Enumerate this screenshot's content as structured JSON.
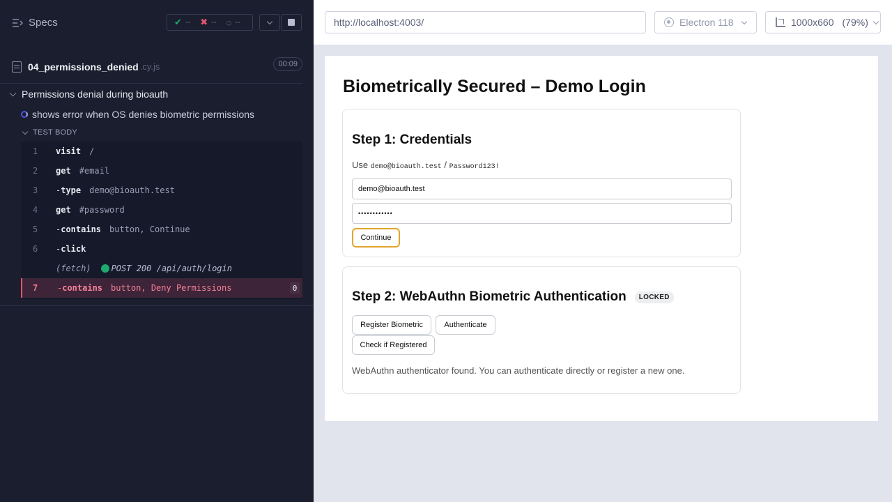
{
  "reporter": {
    "specs_label": "Specs",
    "stats": {
      "passed": "--",
      "failed": "--",
      "pending": "--"
    },
    "spec": {
      "name": "04_permissions_denied",
      "ext": ".cy.js",
      "duration": "00:09"
    },
    "suite": "Permissions denial during bioauth",
    "test": "shows error when OS denies biometric permissions",
    "body_label": "TEST BODY",
    "commands": [
      {
        "num": "1",
        "dash": "",
        "name": "visit",
        "msg": "/"
      },
      {
        "num": "2",
        "dash": "",
        "name": "get",
        "msg": "#email"
      },
      {
        "num": "3",
        "dash": "-",
        "name": "type",
        "msg": "demo@bioauth.test"
      },
      {
        "num": "4",
        "dash": "",
        "name": "get",
        "msg": "#password"
      },
      {
        "num": "5",
        "dash": "-",
        "name": "contains",
        "msg": "button, Continue"
      },
      {
        "num": "6",
        "dash": "-",
        "name": "click",
        "msg": ""
      },
      {
        "num": "",
        "dash": "",
        "name": "(fetch)",
        "msg": "POST 200 /api/auth/login"
      },
      {
        "num": "7",
        "dash": "-",
        "name": "contains",
        "msg": "button, Deny Permissions",
        "badge": "0"
      }
    ]
  },
  "aut": {
    "url": "http://localhost:4003/",
    "browser": "Electron 118",
    "viewport": "1000x660",
    "zoom": "(79%)",
    "page": {
      "title": "Biometrically Secured – Demo Login",
      "step1": {
        "heading": "Step 1: Credentials",
        "hint_prefix": "Use",
        "hint_email": "demo@bioauth.test",
        "hint_sep": "/",
        "hint_password": "Password123!",
        "email_value": "demo@bioauth.test",
        "password_value": "••••••••••••",
        "continue_label": "Continue"
      },
      "step2": {
        "heading": "Step 2: WebAuthn Biometric Authentication",
        "badge": "LOCKED",
        "register_label": "Register Biometric",
        "authenticate_label": "Authenticate",
        "check_label": "Check if Registered",
        "status": "WebAuthn authenticator found. You can authenticate directly or register a new one."
      }
    }
  },
  "colors": {
    "pass": "#1fa971",
    "fail": "#e45770",
    "accent": "#4956e3",
    "focus": "#e2a62d"
  }
}
